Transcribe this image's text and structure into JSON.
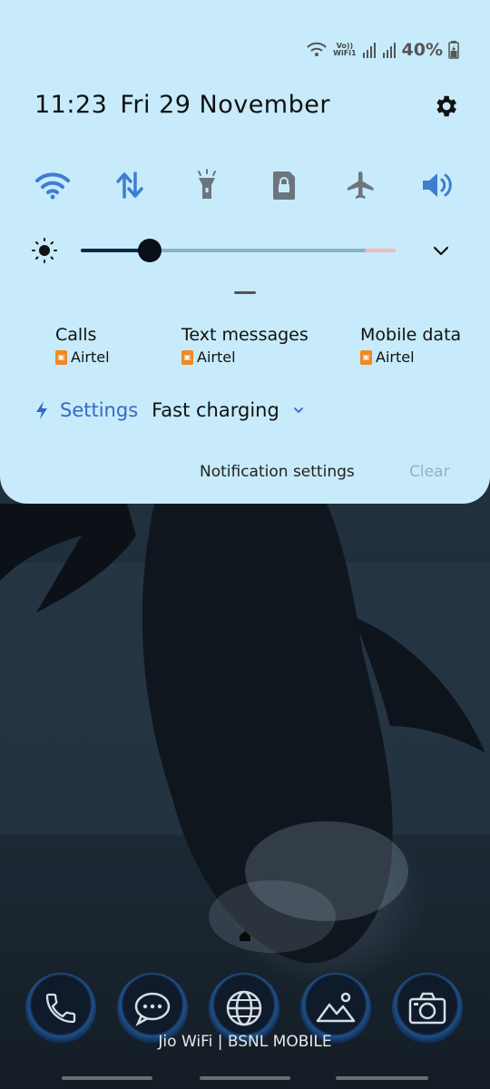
{
  "status_bar": {
    "volte_line1": "Vo))",
    "volte_line2": "WiFi1",
    "battery": "40%"
  },
  "header": {
    "time": "11:23",
    "date": "Fri 29 November"
  },
  "quick_tiles": [
    "wifi-icon",
    "mobile-data-icon",
    "torch-icon",
    "sim-lock-icon",
    "airplane-icon",
    "sound-icon"
  ],
  "brightness": {
    "level": 0.22
  },
  "sim_cards": [
    {
      "title": "Calls",
      "carrier": "Airtel"
    },
    {
      "title": "Text messages",
      "carrier": "Airtel"
    },
    {
      "title": "Mobile data",
      "carrier": "Airtel"
    }
  ],
  "charging": {
    "settings_label": "Settings",
    "status": "Fast charging"
  },
  "footer": {
    "notification_settings": "Notification settings",
    "clear": "Clear"
  },
  "home": {
    "carrier_label": "Jio WiFi | BSNL MOBILE",
    "apps": [
      "phone-icon",
      "messages-icon",
      "browser-icon",
      "gallery-icon",
      "camera-icon"
    ]
  },
  "colors": {
    "panel": "#c7ebfa",
    "accent": "#3569c4",
    "tile_icon": "#3d7ed0"
  }
}
